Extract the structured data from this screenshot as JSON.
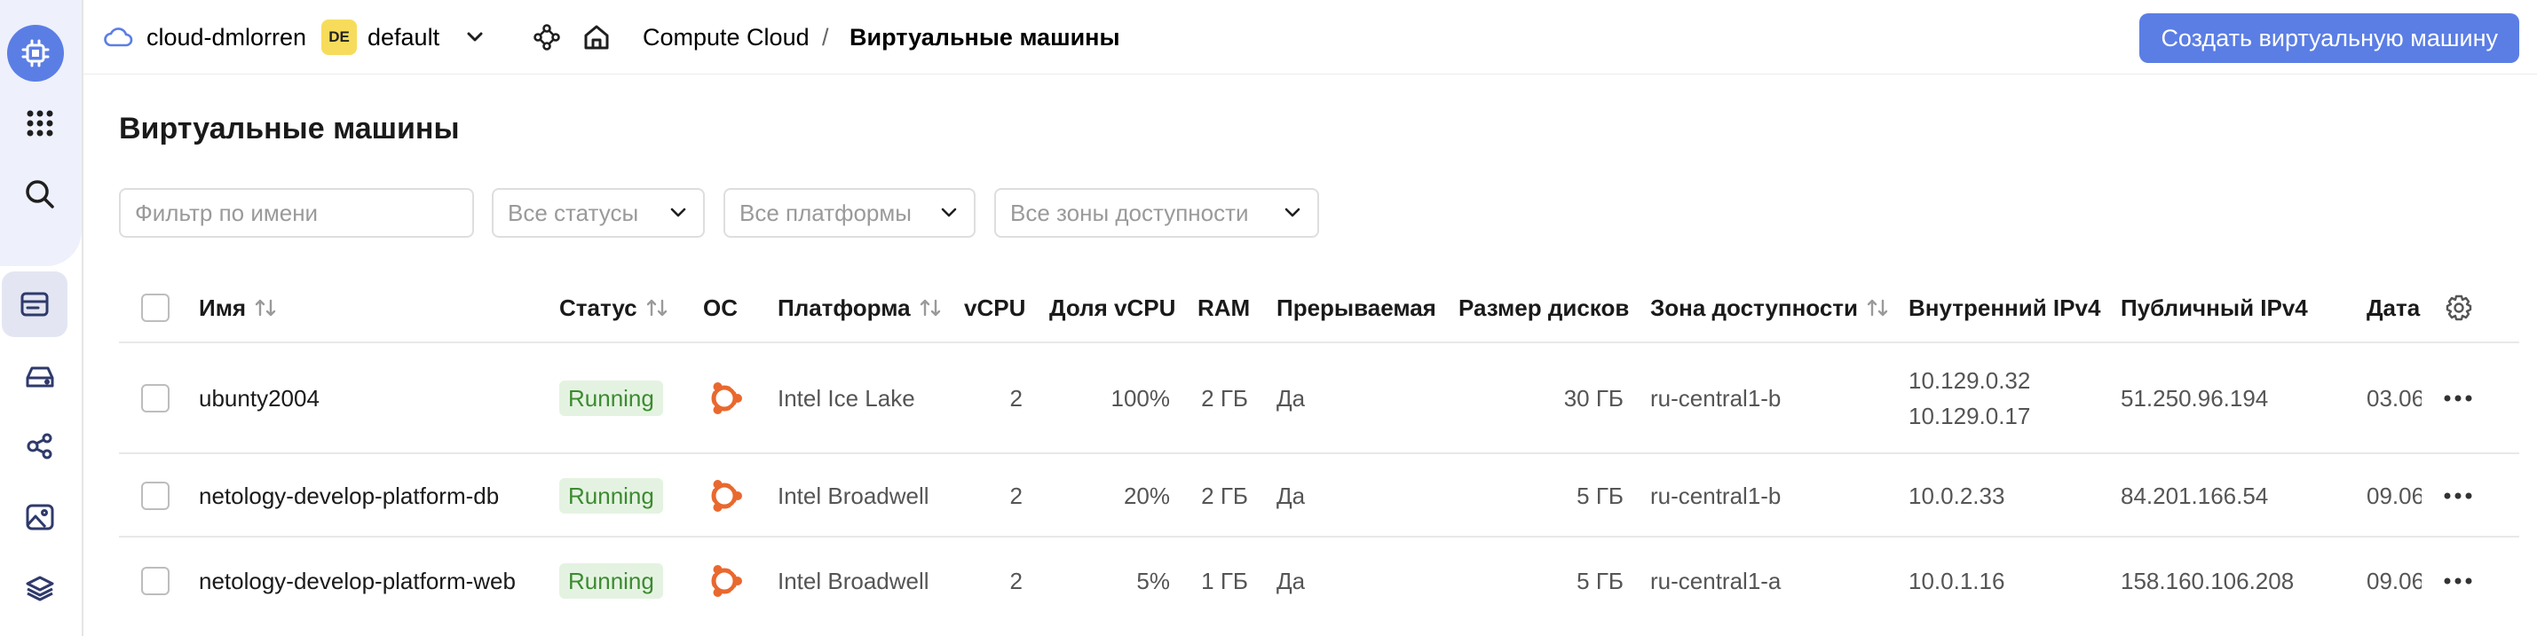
{
  "header": {
    "cloud_name": "cloud-dmlorren",
    "folder_badge": "DE",
    "folder_name": "default",
    "breadcrumb_service": "Compute Cloud",
    "breadcrumb_sep": "/",
    "breadcrumb_current": "Виртуальные машины",
    "create_button": "Создать виртуальную машину"
  },
  "page": {
    "title": "Виртуальные машины"
  },
  "filters": {
    "name_placeholder": "Фильтр по имени",
    "status": "Все статусы",
    "platform": "Все платформы",
    "zone": "Все зоны доступности"
  },
  "table": {
    "columns": {
      "name": "Имя",
      "status": "Статус",
      "os": "ОС",
      "platform": "Платформа",
      "vcpu": "vCPU",
      "vcpu_share": "Доля vCPU",
      "ram": "RAM",
      "preemptible": "Прерываемая",
      "disk_size": "Размер дисков",
      "zone": "Зона доступности",
      "internal_ip": "Внутренний IPv4",
      "public_ip": "Публичный IPv4",
      "date": "Дата"
    },
    "rows": [
      {
        "name": "ubunty2004",
        "status": "Running",
        "platform": "Intel Ice Lake",
        "vcpu": "2",
        "vcpu_share": "100%",
        "ram": "2 ГБ",
        "preemptible": "Да",
        "disk_size": "30 ГБ",
        "zone": "ru-central1-b",
        "internal_ip_1": "10.129.0.32",
        "internal_ip_2": "10.129.0.17",
        "public_ip": "51.250.96.194",
        "date": "03.06"
      },
      {
        "name": "netology-develop-platform-db",
        "status": "Running",
        "platform": "Intel Broadwell",
        "vcpu": "2",
        "vcpu_share": "20%",
        "ram": "2 ГБ",
        "preemptible": "Да",
        "disk_size": "5 ГБ",
        "zone": "ru-central1-b",
        "internal_ip_1": "10.0.2.33",
        "public_ip": "84.201.166.54",
        "date": "09.06"
      },
      {
        "name": "netology-develop-platform-web",
        "status": "Running",
        "platform": "Intel Broadwell",
        "vcpu": "2",
        "vcpu_share": "5%",
        "ram": "1 ГБ",
        "preemptible": "Да",
        "disk_size": "5 ГБ",
        "zone": "ru-central1-a",
        "internal_ip_1": "10.0.1.16",
        "public_ip": "158.160.106.208",
        "date": "09.06"
      }
    ]
  },
  "colors": {
    "accent": "#5b7ee5",
    "running_bg": "#e4f3e1",
    "running_text": "#3c8a31",
    "ubuntu": "#e9682e",
    "folder_badge": "#f7dc5c"
  },
  "icons": {
    "rail": [
      "compute-cloud-icon",
      "all-services-icon",
      "search-icon",
      "virtual-machines-icon",
      "disks-icon",
      "placement-groups-icon",
      "images-icon",
      "layers-icon"
    ],
    "header": [
      "cloud-icon",
      "chevron-down-icon",
      "network-icon",
      "home-icon"
    ],
    "table": [
      "sort-icon",
      "settings-gear-icon",
      "ubuntu-icon",
      "more-icon"
    ]
  }
}
